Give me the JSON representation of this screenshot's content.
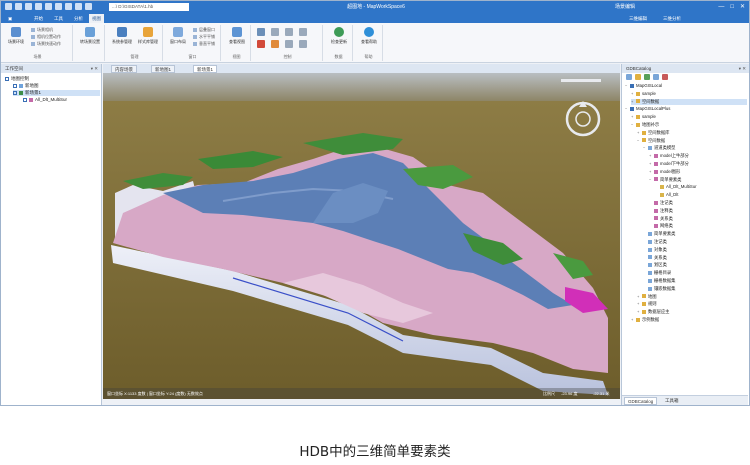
{
  "titlebar": {
    "search_text": "...\\ D:\\GISDATA\\1.hb",
    "window_title": "超图地 - MapWorkSpace6",
    "context_tab": "场景编辑",
    "window_buttons": [
      "—",
      "□",
      "✕"
    ]
  },
  "ribbon_tabs": [
    {
      "label": "▣"
    },
    {
      "label": "开始"
    },
    {
      "label": "工具"
    },
    {
      "label": "分析"
    },
    {
      "label": "视图"
    }
  ],
  "ribbon_right_tabs": [
    "三维编辑",
    "三维分析"
  ],
  "ribbon": {
    "groups": [
      {
        "label": "场景"
      },
      {
        "label": "管理"
      },
      {
        "label": "窗口"
      },
      {
        "label": "视图"
      },
      {
        "label": "控制"
      },
      {
        "label": "数据"
      },
      {
        "label": "帮助"
      }
    ],
    "buttons": [
      {
        "label": "场景环境"
      },
      {
        "label": "转场景设置"
      },
      {
        "label": "系统参管理"
      },
      {
        "label": "样式库管理"
      },
      {
        "label": "窗口布局"
      },
      {
        "label": "查看视图"
      },
      {
        "label": "检查更新"
      },
      {
        "label": "查看帮助"
      }
    ],
    "small_buttons": [
      "场景相机",
      "相机位置动作",
      "场景快速动作",
      "层叠窗口",
      "水平平铺",
      "垂直平铺"
    ]
  },
  "left_panel": {
    "title": "工作空间",
    "controls": "▾ ✕",
    "tree": [
      {
        "label": "地图控制",
        "level": 0
      },
      {
        "label": "新地图",
        "level": 1
      },
      {
        "label": "新场景1",
        "level": 1,
        "selected": true
      },
      {
        "label": "All_Dlt_MultiSur",
        "level": 2
      }
    ]
  },
  "doc_tabs": [
    {
      "label": "内容场景",
      "active": false
    },
    {
      "label": "新地图1",
      "active": false
    },
    {
      "label": "新场景1",
      "active": true
    }
  ],
  "scene_status": {
    "left": "窗口坐标 X:1133 度数 | 窗口坐标 Y:24 (度数) 无数效点",
    "scale": "比例尺",
    "lon": "-23.96 度",
    "lat": "-22.31 米"
  },
  "right_panel": {
    "title": "GDBCatalog",
    "controls": "▾ ✕",
    "tree": [
      {
        "label": "MapGISLocal",
        "level": 0,
        "expander": "−"
      },
      {
        "label": "sample",
        "level": 1,
        "expander": "+"
      },
      {
        "label": "空间数据",
        "level": 1,
        "expander": "+",
        "selected": true
      },
      {
        "label": "MapGISLocalPlus",
        "level": 0,
        "expander": "−"
      },
      {
        "label": "sample",
        "level": 1,
        "expander": "+"
      },
      {
        "label": "地图补示",
        "level": 1,
        "expander": "−"
      },
      {
        "label": "空间数据库",
        "level": 2,
        "expander": "+"
      },
      {
        "label": "空间数据",
        "level": 2,
        "expander": "−"
      },
      {
        "label": "道道类模型",
        "level": 3,
        "expander": "−"
      },
      {
        "label": "model上牛部分",
        "level": 4,
        "expander": "+"
      },
      {
        "label": "model下牛部分",
        "level": 4,
        "expander": "+"
      },
      {
        "label": "model图形",
        "level": 4,
        "expander": "+"
      },
      {
        "label": "简单要素类",
        "level": 4,
        "expander": "−"
      },
      {
        "label": "All_Dlt_MultiSur",
        "level": 5,
        "expander": ""
      },
      {
        "label": "All_Dlt",
        "level": 5,
        "expander": ""
      },
      {
        "label": "注记类",
        "level": 4,
        "expander": ""
      },
      {
        "label": "注释类",
        "level": 4,
        "expander": ""
      },
      {
        "label": "关系类",
        "level": 4,
        "expander": ""
      },
      {
        "label": "网络类",
        "level": 4,
        "expander": ""
      },
      {
        "label": "简单要素类",
        "level": 3,
        "expander": ""
      },
      {
        "label": "注记类",
        "level": 3,
        "expander": ""
      },
      {
        "label": "对象类",
        "level": 3,
        "expander": ""
      },
      {
        "label": "关系类",
        "level": 3,
        "expander": ""
      },
      {
        "label": "划区类",
        "level": 3,
        "expander": ""
      },
      {
        "label": "栅格目录",
        "level": 3,
        "expander": ""
      },
      {
        "label": "栅格数据集",
        "level": 3,
        "expander": ""
      },
      {
        "label": "镶嵌数据集",
        "level": 3,
        "expander": ""
      },
      {
        "label": "地图",
        "level": 2,
        "expander": "+"
      },
      {
        "label": "规则",
        "level": 2,
        "expander": "+"
      },
      {
        "label": "数据层应主",
        "level": 2,
        "expander": "+"
      },
      {
        "label": "示例数据",
        "level": 1,
        "expander": "+"
      }
    ],
    "bottom_tabs": [
      {
        "label": "GDBCatalog",
        "active": true
      },
      {
        "label": "工具箱",
        "active": false
      }
    ]
  },
  "caption": "HDB中的三维简单要素类",
  "colors": {
    "accent": "#2f75c8",
    "panel_header": "#dde6f2",
    "terrain_pink": "#d9a9c8",
    "water_blue": "#5a7fb8",
    "vegetation_green": "#3f8d3a",
    "ground_brown": "#7d6b37",
    "sky_gray": "#c8cdd2"
  }
}
